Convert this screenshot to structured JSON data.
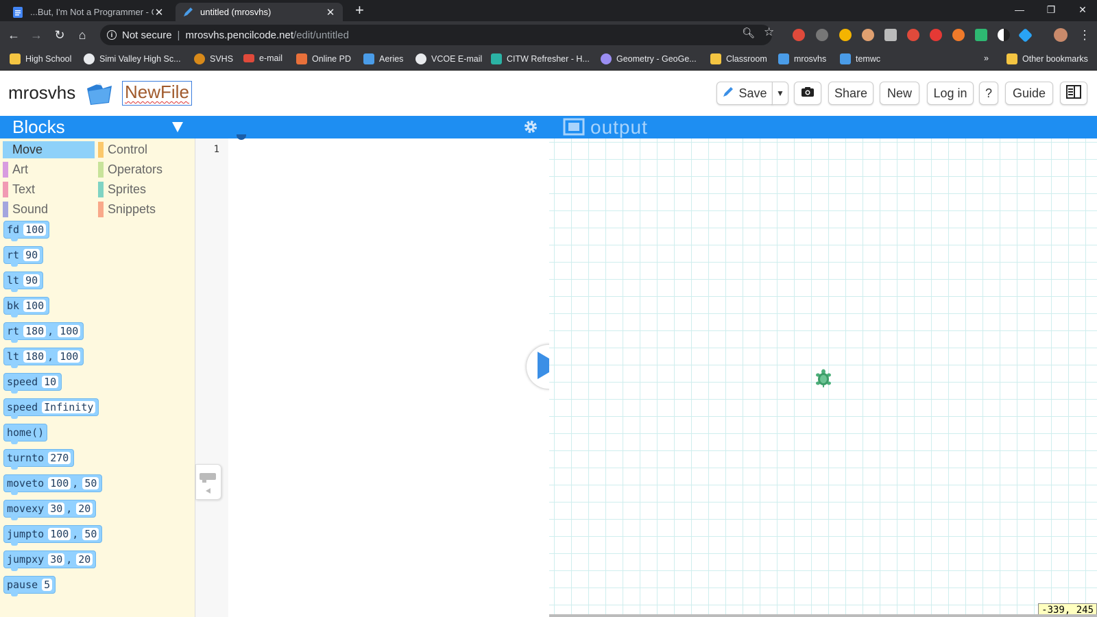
{
  "browser": {
    "tabs": [
      {
        "title": "...But, I'm Not a Programmer - G",
        "icon": "docs-icon"
      },
      {
        "title": "untitled (mrosvhs)",
        "icon": "pencil-icon"
      }
    ],
    "address": {
      "security": "Not secure",
      "host": "mrosvhs.pencilcode.net",
      "path": "/edit/untitled"
    },
    "bookmarks": [
      {
        "label": "High School",
        "icon": "folder-icon",
        "color": "#f4c542"
      },
      {
        "label": "Simi Valley High Sc...",
        "icon": "globe-icon",
        "color": "#e8eaed"
      },
      {
        "label": "SVHS",
        "icon": "svhs-icon",
        "color": "#d88a1a"
      },
      {
        "label": "e-mail",
        "icon": "gmail-icon",
        "color": "#e04a3b"
      },
      {
        "label": "Online PD",
        "icon": "pd-icon",
        "color": "#e8703a"
      },
      {
        "label": "Aeries",
        "icon": "aeries-icon",
        "color": "#4a9ce8"
      },
      {
        "label": "VCOE E-mail",
        "icon": "globe-icon",
        "color": "#e8eaed"
      },
      {
        "label": "CITW Refresher - H...",
        "icon": "citw-icon",
        "color": "#2bb3a5"
      },
      {
        "label": "Geometry - GeoGe...",
        "icon": "geogebra-icon",
        "color": "#9b8ef2"
      },
      {
        "label": "Classroom",
        "icon": "classroom-icon",
        "color": "#f4c542"
      },
      {
        "label": "mrosvhs",
        "icon": "pencil-icon",
        "color": "#4a9ce8"
      },
      {
        "label": "temwc",
        "icon": "pencil-icon",
        "color": "#4a9ce8"
      }
    ],
    "more": "»",
    "other_bookmarks": "Other bookmarks"
  },
  "header": {
    "site_name": "mrosvhs",
    "filename": "NewFile",
    "buttons": {
      "save": "Save",
      "share": "Share",
      "new": "New",
      "login": "Log in",
      "help": "?",
      "guide": "Guide"
    }
  },
  "palette": {
    "title": "Blocks",
    "categories": [
      {
        "label": "Move",
        "color": "#8ed1f9"
      },
      {
        "label": "Control",
        "color": "#fbc86b"
      },
      {
        "label": "Art",
        "color": "#d89ce0"
      },
      {
        "label": "Operators",
        "color": "#c8e39a"
      },
      {
        "label": "Text",
        "color": "#f19ab4"
      },
      {
        "label": "Sprites",
        "color": "#7fd3c3"
      },
      {
        "label": "Sound",
        "color": "#a4a6de"
      },
      {
        "label": "Snippets",
        "color": "#f9a98a"
      }
    ],
    "blocks": [
      {
        "cmd": "fd",
        "args": [
          "100"
        ]
      },
      {
        "cmd": "rt",
        "args": [
          "90"
        ]
      },
      {
        "cmd": "lt",
        "args": [
          "90"
        ]
      },
      {
        "cmd": "bk",
        "args": [
          "100"
        ]
      },
      {
        "cmd": "rt",
        "args": [
          "180",
          "100"
        ]
      },
      {
        "cmd": "lt",
        "args": [
          "180",
          "100"
        ]
      },
      {
        "cmd": "speed",
        "args": [
          "10"
        ]
      },
      {
        "cmd": "speed",
        "args": [
          "Infinity"
        ]
      },
      {
        "cmd": "home()",
        "args": []
      },
      {
        "cmd": "turnto",
        "args": [
          "270"
        ]
      },
      {
        "cmd": "moveto",
        "args": [
          "100",
          "50"
        ]
      },
      {
        "cmd": "movexy",
        "args": [
          "30",
          "20"
        ]
      },
      {
        "cmd": "jumpto",
        "args": [
          "100",
          "50"
        ]
      },
      {
        "cmd": "jumpxy",
        "args": [
          "30",
          "20"
        ]
      },
      {
        "cmd": "pause",
        "args": [
          "5"
        ]
      }
    ]
  },
  "editor": {
    "line_numbers": [
      "1"
    ]
  },
  "output": {
    "title": "output",
    "coords": "-339, 245"
  },
  "colors": {
    "accent": "#1e8ef2",
    "block": "#92d1ff",
    "palette_bg": "#fef9df",
    "grid": "#cfeeee",
    "turtle": "#4caf7a"
  }
}
